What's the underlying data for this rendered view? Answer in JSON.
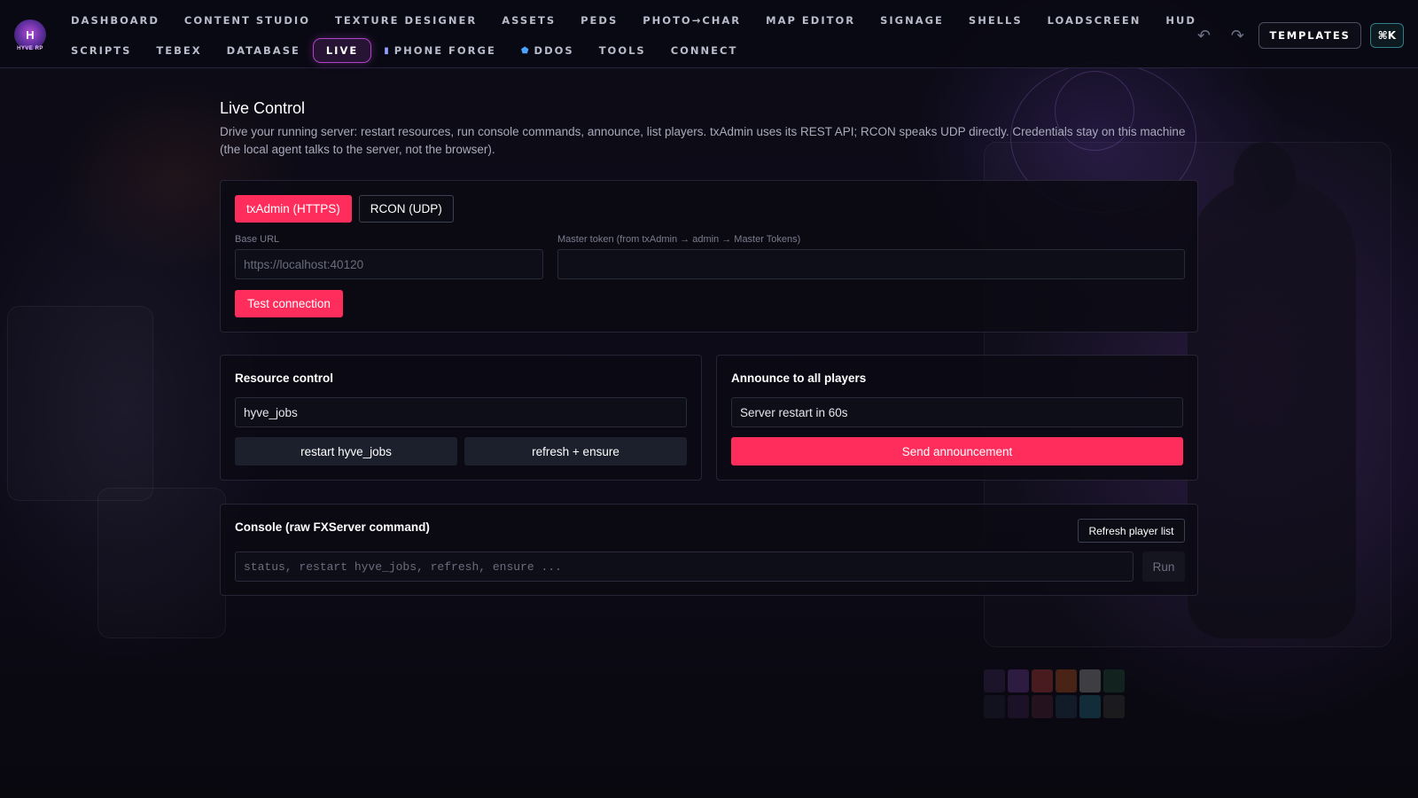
{
  "app": {
    "logo_text": "H",
    "logo_sub": "HYVE RP"
  },
  "nav": {
    "row1": [
      {
        "label": "DASHBOARD"
      },
      {
        "label": "CONTENT STUDIO"
      },
      {
        "label": "TEXTURE DESIGNER"
      },
      {
        "label": "ASSETS"
      },
      {
        "label": "PEDS"
      },
      {
        "label": "PHOTO→CHAR"
      },
      {
        "label": "MAP EDITOR"
      },
      {
        "label": "SIGNAGE"
      },
      {
        "label": "SHELLS"
      },
      {
        "label": "LOADSCREEN"
      },
      {
        "label": "HUD"
      }
    ],
    "row2": [
      {
        "label": "SCRIPTS"
      },
      {
        "label": "TEBEX"
      },
      {
        "label": "DATABASE"
      },
      {
        "label": "LIVE",
        "active": true
      },
      {
        "label": "PHONE FORGE",
        "icon": "phone-icon"
      },
      {
        "label": "DDOS",
        "icon": "shield-icon"
      },
      {
        "label": "TOOLS"
      },
      {
        "label": "CONNECT"
      }
    ],
    "undo_icon": "undo-icon",
    "redo_icon": "redo-icon",
    "templates_label": "TEMPLATES",
    "cmdk_label": "⌘K"
  },
  "page": {
    "title": "Live Control",
    "description": "Drive your running server: restart resources, run console commands, announce, list players. txAdmin uses its REST API; RCON speaks UDP directly. Credentials stay on this machine (the local agent talks to the server, not the browser)."
  },
  "connection": {
    "tabs": [
      {
        "label": "txAdmin (HTTPS)",
        "active": true
      },
      {
        "label": "RCON (UDP)",
        "active": false
      }
    ],
    "base_url_label": "Base URL",
    "base_url_placeholder": "https://localhost:40120",
    "base_url_value": "",
    "token_label": "Master token (from txAdmin → admin → Master Tokens)",
    "token_value": "",
    "test_button": "Test connection"
  },
  "resource_control": {
    "title": "Resource control",
    "resource_value": "hyve_jobs",
    "restart_button": "restart hyve_jobs",
    "refresh_button": "refresh + ensure"
  },
  "announce": {
    "title": "Announce to all players",
    "message_value": "Server restart in 60s",
    "send_button": "Send announcement"
  },
  "console": {
    "title": "Console (raw FXServer command)",
    "refresh_players_button": "Refresh player list",
    "command_placeholder": "status, restart hyve_jobs, refresh, ensure ...",
    "run_button": "Run"
  },
  "colors": {
    "accent": "#ff2d5b",
    "active_nav": "#b143c9",
    "background": "#0a0913"
  }
}
